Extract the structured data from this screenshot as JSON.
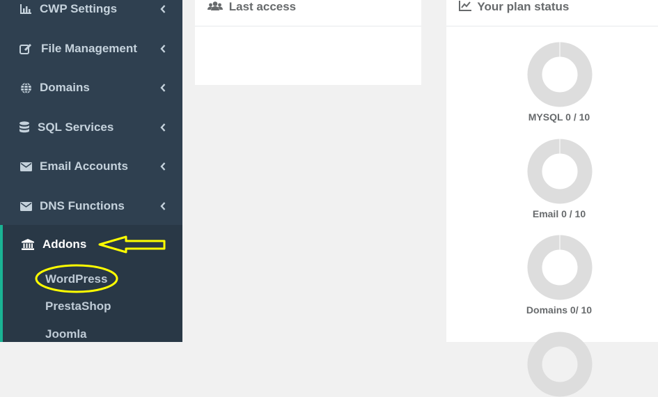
{
  "sidebar": {
    "items": [
      {
        "label": "CWP Settings",
        "icon": "bar-chart-icon"
      },
      {
        "label": "File Management",
        "icon": "edit-icon"
      },
      {
        "label": "Domains",
        "icon": "globe-icon"
      },
      {
        "label": "SQL Services",
        "icon": "database-icon"
      },
      {
        "label": "Email Accounts",
        "icon": "envelope-icon"
      },
      {
        "label": "DNS Functions",
        "icon": "envelope-icon"
      }
    ],
    "active": {
      "label": "Addons",
      "icon": "bank-icon",
      "subitems": [
        "WordPress",
        "PrestaShop",
        "Joomla"
      ]
    }
  },
  "panels": {
    "last_access": {
      "title": "Last access",
      "icon": "users-icon"
    },
    "plan_status": {
      "title": "Your plan status",
      "icon": "line-chart-icon",
      "stats": [
        {
          "label": "MYSQL 0 / 10",
          "used": 0,
          "total": 10
        },
        {
          "label": "Email 0 / 10",
          "used": 0,
          "total": 10
        },
        {
          "label": "Domains 0/ 10",
          "used": 0,
          "total": 10
        }
      ]
    }
  },
  "colors": {
    "sidebar_bg": "#2f4050",
    "active_bg": "#293846",
    "accent": "#1ab394",
    "annotation": "#ffff00",
    "donut_gray": "#dddddd"
  }
}
